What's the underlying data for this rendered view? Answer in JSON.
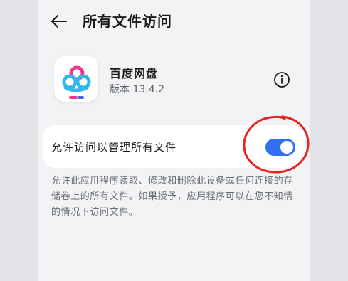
{
  "header": {
    "title": "所有文件访问",
    "back_icon": "arrow-left-icon"
  },
  "app": {
    "name": "百度网盘",
    "version": "版本 13.4.2",
    "icon": "baidu-netdisk-logo",
    "info_icon": "info-icon"
  },
  "setting": {
    "label": "允许访问以管理所有文件",
    "enabled": true,
    "accent_color": "#2f6ff0",
    "description": "允许此应用程序读取、修改和删除此设备或任何连接的存储卷上的所有文件。如果授予，应用程序可以在您不知情的情况下访问文件。"
  },
  "annotation_color": "#e8231f"
}
